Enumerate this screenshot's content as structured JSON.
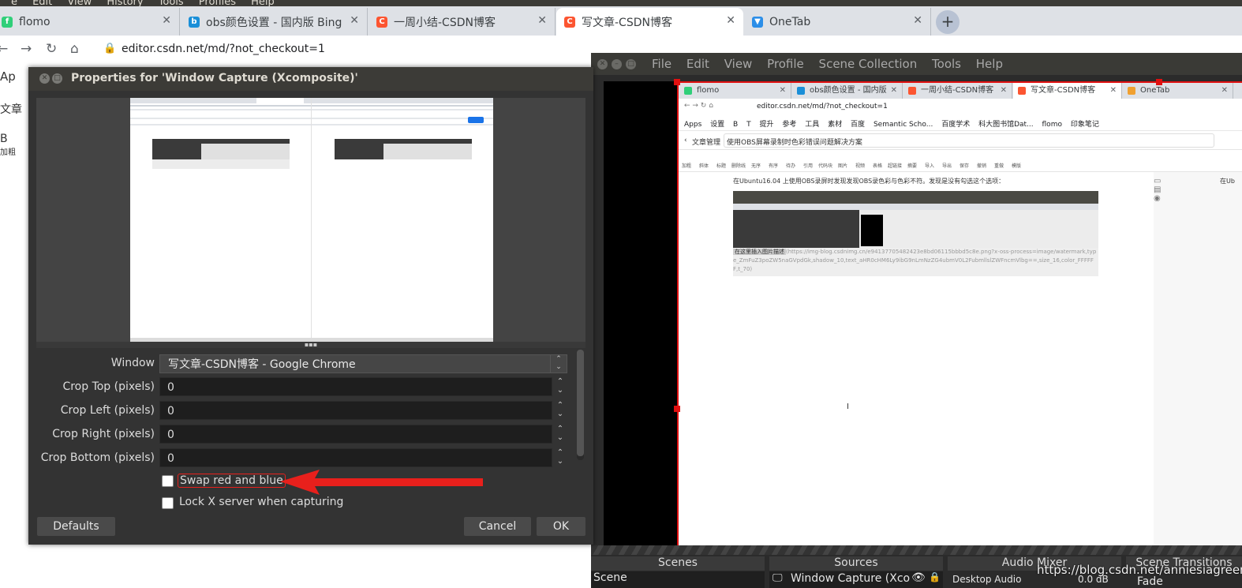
{
  "browser": {
    "menu": [
      "e",
      "Edit",
      "View",
      "History",
      "Tools",
      "Profiles",
      "Help"
    ],
    "tabs": [
      {
        "title": "flomo",
        "icon": "flomo-icon",
        "color": "#30cf79"
      },
      {
        "title": "obs颜色设置 - 国内版 Bing",
        "icon": "bing-icon",
        "color": "#1a8fd8"
      },
      {
        "title": "一周小结-CSDN博客",
        "icon": "csdn-icon",
        "color": "#fc5531"
      },
      {
        "title": "写文章-CSDN博客",
        "icon": "csdn-icon",
        "color": "#fc5531",
        "active": true
      },
      {
        "title": "OneTab",
        "icon": "onetab-icon",
        "color": "#2b8ee8"
      }
    ],
    "url": "editor.csdn.net/md/?not_checkout=1",
    "bookmarks_partial": "Ap",
    "left_fragments": {
      "a": "文章",
      "b": "B",
      "c": "加粗"
    }
  },
  "obs": {
    "menu": [
      "File",
      "Edit",
      "View",
      "Profile",
      "Scene Collection",
      "Tools",
      "Help"
    ],
    "docks": {
      "scenes": "Scenes",
      "sources": "Sources",
      "mixer": "Audio Mixer",
      "transitions": "Scene Transitions"
    },
    "scene_item": "Scene",
    "source_item": "Window Capture (Xco",
    "mixer_item": "Desktop Audio",
    "mixer_db": "0.0 dB",
    "transition_item": "Fade",
    "watermark": "https://blog.csdn.net/anniesiagreen"
  },
  "nested": {
    "tabs": [
      "flomo",
      "obs颜色设置 - 国内版 Bing",
      "一周小结-CSDN博客",
      "写文章-CSDN博客",
      "OneTab"
    ],
    "url": "editor.csdn.net/md/?not_checkout=1",
    "bookmarks": [
      "Apps",
      "设置",
      "B",
      "T",
      "提升",
      "参考",
      "工具",
      "素材",
      "百度",
      "Semantic Scho...",
      "百度学术",
      "科大图书馆Dat...",
      "flomo",
      "印象笔记"
    ],
    "back": "文章管理",
    "article_title": "使用OBS屏幕录制时色彩错误问题解决方案",
    "tools": [
      "加粗",
      "斜体",
      "标题",
      "删除线",
      "无序",
      "有序",
      "待办",
      "引用",
      "代码块",
      "图片",
      "视频",
      "表格",
      "超链接",
      "摘要",
      "导入",
      "导出",
      "保存",
      "撤销",
      "重做",
      "模版"
    ],
    "body_text": "在Ubuntu16.04 上使用OBS录屏时发现发现OBS录色彩与色彩不符。发现是没有勾选这个选项：",
    "caption_highlight": "在这里插入图片描述",
    "caption_rest": "(https://img-blog.csdnimg.cn/e94137705482423e8bd06115bbbd5c8e.png?x-oss-process=image/watermark,type_ZmFuZ3poZW5naGVpdGk,shadow_10,text_aHR0cHM6Ly9ibG9nLmNzZG4ubmV0L2FubmllslZWFncmVlbg==,size_16,color_FFFFFF,t_70)",
    "side_text": "在Ub"
  },
  "dialog": {
    "title": "Properties for 'Window Capture (Xcomposite)'",
    "fields": [
      {
        "label": "Window",
        "value": "写文章-CSDN博客 - Google Chrome",
        "type": "combo"
      },
      {
        "label": "Crop Top (pixels)",
        "value": "0"
      },
      {
        "label": "Crop Left (pixels)",
        "value": "0"
      },
      {
        "label": "Crop Right (pixels)",
        "value": "0"
      },
      {
        "label": "Crop Bottom (pixels)",
        "value": "0"
      }
    ],
    "checkboxes": [
      {
        "label": "Swap red and blue",
        "checked": false,
        "highlighted": true
      },
      {
        "label": "Lock X server when capturing",
        "checked": false
      }
    ],
    "buttons": {
      "defaults": "Defaults",
      "cancel": "Cancel",
      "ok": "OK"
    },
    "annotation_arrow_color": "#e8201c"
  }
}
